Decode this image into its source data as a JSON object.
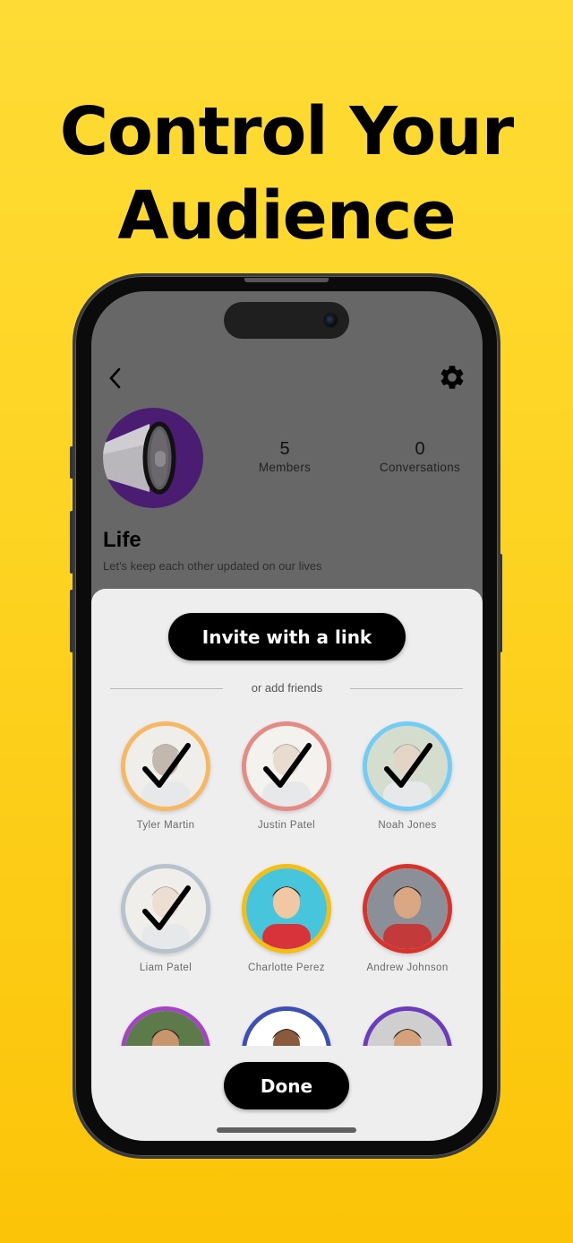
{
  "headline": {
    "line1": "Control Your",
    "line2": "Audience"
  },
  "colors": {
    "background_top": "#fedc35",
    "background_bottom": "#fbc408",
    "accent_button": "#000000",
    "sheet": "#eeeeee"
  },
  "group": {
    "name": "Life",
    "description": "Let's keep each other updated on our lives",
    "avatar_icon": "megaphone-icon",
    "stats": [
      {
        "value": "5",
        "label": "Members"
      },
      {
        "value": "0",
        "label": "Conversations"
      }
    ]
  },
  "header": {
    "back_icon": "chevron-left-icon",
    "settings_icon": "gear-icon"
  },
  "sheet": {
    "invite_label": "Invite with a link",
    "divider_label": "or add friends",
    "done_label": "Done",
    "friends": [
      {
        "name": "Tyler Martin",
        "ring_color": "#f7b865",
        "selected": true
      },
      {
        "name": "Justin Patel",
        "ring_color": "#e48b86",
        "selected": true
      },
      {
        "name": "Noah Jones",
        "ring_color": "#74ccf4",
        "selected": true
      },
      {
        "name": "Liam Patel",
        "ring_color": "#b7c3cc",
        "selected": true
      },
      {
        "name": "Charlotte Perez",
        "ring_color": "#f6bd12",
        "selected": false
      },
      {
        "name": "Andrew Johnson",
        "ring_color": "#d7322c",
        "selected": false
      },
      {
        "name": "",
        "ring_color": "#a344c5",
        "selected": false
      },
      {
        "name": "",
        "ring_color": "#3d4fb5",
        "selected": false
      },
      {
        "name": "",
        "ring_color": "#6b3dbd",
        "selected": false
      }
    ]
  }
}
